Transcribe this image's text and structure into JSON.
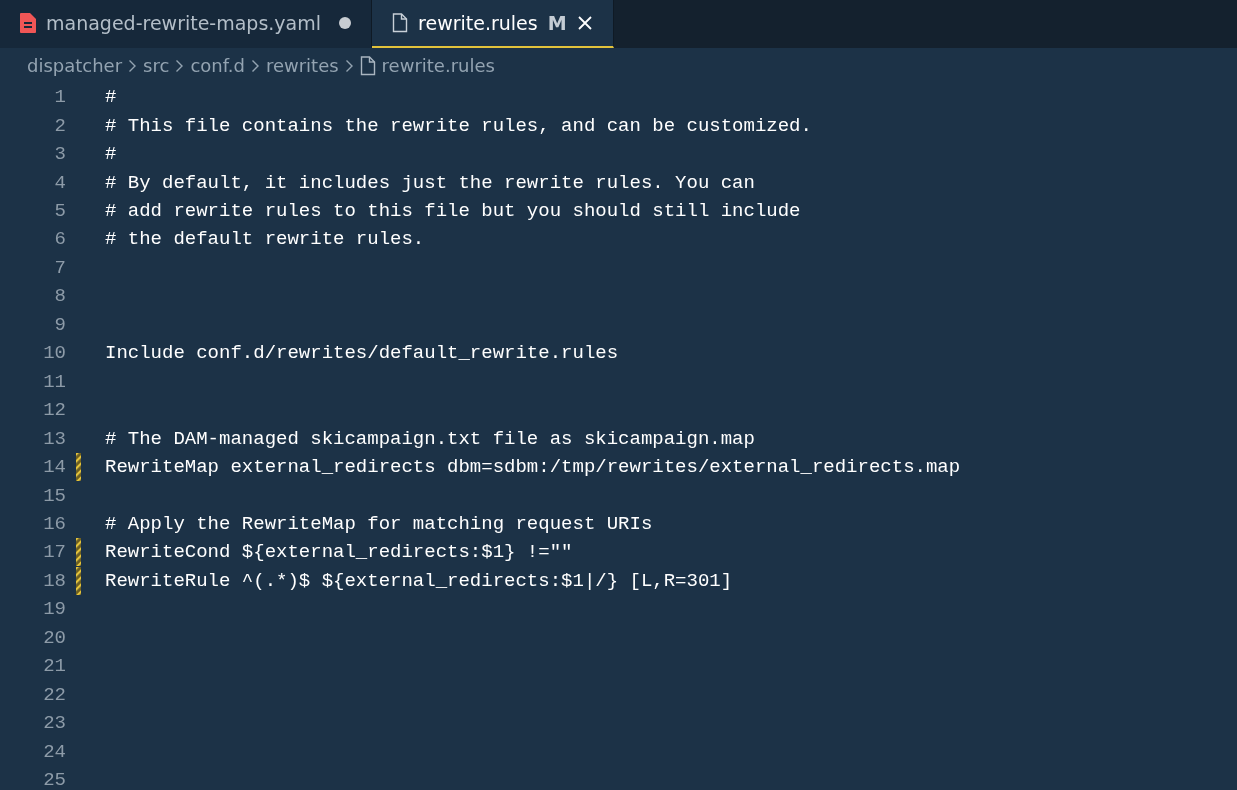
{
  "tabs": [
    {
      "label": "managed-rewrite-maps.yaml",
      "kind": "yaml",
      "selected": false,
      "dirty": true
    },
    {
      "label": "rewrite.rules",
      "kind": "file",
      "selected": true,
      "dirty": false,
      "badge": "M"
    }
  ],
  "breadcrumb": [
    "dispatcher",
    "src",
    "conf.d",
    "rewrites",
    "rewrite.rules"
  ],
  "lines": [
    {
      "number": "1",
      "text": "#",
      "modified": false
    },
    {
      "number": "2",
      "text": "# This file contains the rewrite rules, and can be customized.",
      "modified": false
    },
    {
      "number": "3",
      "text": "#",
      "modified": false
    },
    {
      "number": "4",
      "text": "# By default, it includes just the rewrite rules. You can",
      "modified": false
    },
    {
      "number": "5",
      "text": "# add rewrite rules to this file but you should still include",
      "modified": false
    },
    {
      "number": "6",
      "text": "# the default rewrite rules.",
      "modified": false
    },
    {
      "number": "7",
      "modified": false
    },
    {
      "number": "8",
      "modified": false
    },
    {
      "number": "9",
      "modified": false
    },
    {
      "number": "10",
      "text": "Include conf.d/rewrites/default_rewrite.rules",
      "modified": false
    },
    {
      "number": "11",
      "modified": false
    },
    {
      "number": "12",
      "modified": false
    },
    {
      "number": "13",
      "text": "# The DAM-managed skicampaign.txt file as skicampaign.map",
      "modified": false
    },
    {
      "number": "14",
      "text": "RewriteMap external_redirects dbm=sdbm:/tmp/rewrites/external_redirects.map",
      "modified": true
    },
    {
      "number": "15",
      "modified": false
    },
    {
      "number": "16",
      "text": "# Apply the RewriteMap for matching request URIs",
      "modified": false
    },
    {
      "number": "17",
      "text": "RewriteCond ${external_redirects:$1} !=\"\"",
      "modified": true
    },
    {
      "number": "18",
      "text": "RewriteRule ^(.*)$ ${external_redirects:$1|/} [L,R=301]",
      "modified": true
    },
    {
      "number": "19",
      "modified": false
    },
    {
      "number": "20",
      "modified": false
    },
    {
      "number": "21",
      "modified": false
    },
    {
      "number": "22",
      "modified": false
    },
    {
      "number": "23",
      "modified": false
    },
    {
      "number": "24",
      "modified": false
    },
    {
      "number": "25",
      "modified": false
    }
  ]
}
